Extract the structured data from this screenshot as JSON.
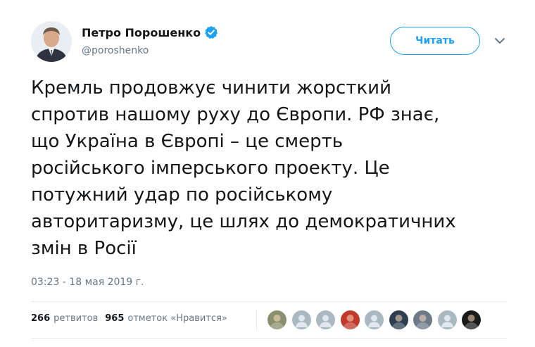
{
  "author": {
    "name": "Петро Порошенко",
    "handle": "@poroshenko",
    "avatar_icon": "profile-photo",
    "verified_icon": "verified-badge-icon",
    "verified_color": "#1da1f2"
  },
  "follow_button": {
    "label": "Читать"
  },
  "menu": {
    "icon": "chevron-down-icon"
  },
  "tweet": {
    "text": "Кремль продовжує чинити жорсткий\nспротив нашому руху до Європи. РФ знає,\nщо Україна в Європі – це смерть\nросійського імперського проекту. Це\nпотужний удар по російському\nавторитаризму, це шлях до демократичних\nзмін в Росії",
    "timestamp": "03:23 - 18 мая 2019 г."
  },
  "stats": {
    "retweets_count": "266",
    "retweets_label": "ретвитов",
    "likes_count": "965",
    "likes_label": "отметок «Нравится»"
  },
  "likers": [
    {
      "icon": "avatar-photo",
      "bg": "#8a8f6e",
      "kind": "photo"
    },
    {
      "icon": "default-avatar-icon",
      "bg": "#aab8c2",
      "kind": "default"
    },
    {
      "icon": "default-avatar-icon",
      "bg": "#aab8c2",
      "kind": "default"
    },
    {
      "icon": "avatar-photo",
      "bg": "#c0392b",
      "kind": "photo"
    },
    {
      "icon": "default-avatar-icon",
      "bg": "#aab8c2",
      "kind": "default"
    },
    {
      "icon": "avatar-photo",
      "bg": "#2c3e50",
      "kind": "photo"
    },
    {
      "icon": "avatar-photo",
      "bg": "#6c7a89",
      "kind": "photo"
    },
    {
      "icon": "default-avatar-icon",
      "bg": "#aab8c2",
      "kind": "default"
    },
    {
      "icon": "avatar-photo",
      "bg": "#1a1a1a",
      "kind": "photo"
    }
  ]
}
